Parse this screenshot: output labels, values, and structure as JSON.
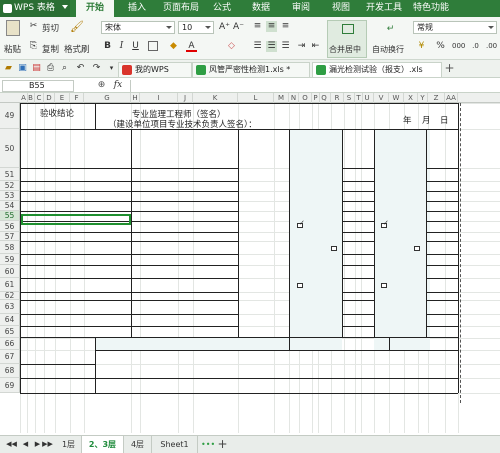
{
  "app": {
    "name": "WPS 表格",
    "accent": "#2f7d3a"
  },
  "menus": [
    "开始",
    "插入",
    "页面布局",
    "公式",
    "数据",
    "审阅",
    "视图",
    "开发工具",
    "特色功能"
  ],
  "ribbon": {
    "clipboard": {
      "cut": "剪切",
      "paste": "粘贴",
      "copy": "复制",
      "format_painter": "格式刷"
    },
    "font": {
      "name": "宋体",
      "size": "10",
      "bold": "B",
      "italic": "I",
      "underline": "U",
      "grow": "A⁺",
      "shrink": "A⁻"
    },
    "merge": "合并居中",
    "wrap": "自动换行",
    "number_format": "常规",
    "percent": "%"
  },
  "doc_tabs": [
    {
      "label": "我的WPS",
      "color": "#d9342b"
    },
    {
      "label": "风管严密性检测1.xls *",
      "color": "#2f9e44"
    },
    {
      "label": "漏光检测试验（报支）.xls",
      "color": "#2f9e44"
    }
  ],
  "formula_bar": {
    "cell_ref": "B55",
    "fx": "fx",
    "formula": ""
  },
  "columns": [
    "A",
    "B",
    "C",
    "D",
    "E",
    "F",
    "G",
    "H",
    "I",
    "J",
    "K",
    "L",
    "M",
    "N",
    "O",
    "P",
    "Q",
    "R",
    "S",
    "T",
    "U",
    "V",
    "W",
    "X",
    "Y",
    "Z",
    "AA"
  ],
  "rows": [
    "49",
    "50",
    "51",
    "52",
    "53",
    "54",
    "55",
    "56",
    "57",
    "58",
    "59",
    "60",
    "61",
    "62",
    "63",
    "64",
    "65",
    "66",
    "67",
    "68",
    "69"
  ],
  "selected_row": "55",
  "sheet": {
    "acceptance_label": "验收结论",
    "supervisor": "专业监理工程师（签名）",
    "tech_lead": "（建设单位项目专业技术负责人签名）：",
    "date_year": "年",
    "date_month": "月",
    "date_day": "日"
  },
  "sheet_tabs": [
    "1层",
    "2、3层",
    "4层",
    "Sheet1"
  ],
  "active_sheet": "2、3层"
}
